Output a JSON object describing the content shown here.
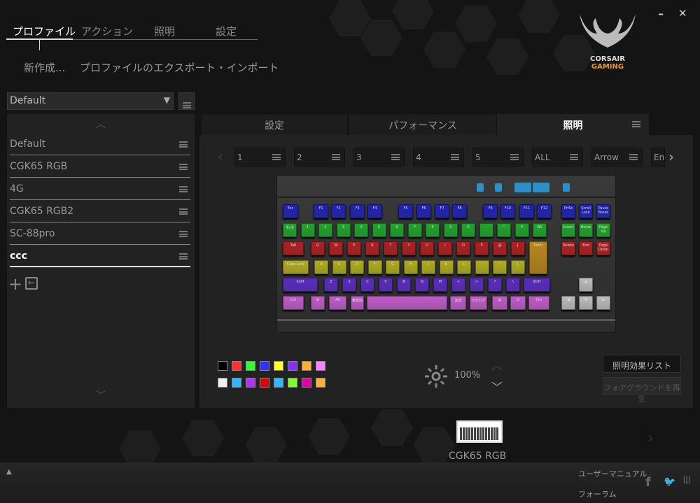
{
  "top_tabs": [
    "プロファイル",
    "アクション",
    "照明",
    "設定"
  ],
  "actions": {
    "new": "新作成...",
    "export_import": "プロファイルのエクスポート・インポート"
  },
  "logo": {
    "line1": "CORSAIR",
    "line2": "GAMING"
  },
  "window": {
    "minimize": "–",
    "close": "✕"
  },
  "profile_select": {
    "value": "Default"
  },
  "profiles": [
    "Default",
    "CGK65 RGB",
    "4G",
    "CGK65 RGB2",
    "SC-88pro",
    "ccc"
  ],
  "selected_profile": "ccc",
  "main_tabs": [
    "設定",
    "パフォーマンス",
    "照明"
  ],
  "active_main_tab": "照明",
  "sub_tabs": [
    "1",
    "2",
    "3",
    "4",
    "5",
    "ALL",
    "Arrow",
    "En"
  ],
  "keyboard": {
    "rows": [
      [
        "Esc",
        "F1",
        "F2",
        "F3",
        "F4",
        "F5",
        "F6",
        "F7",
        "F8",
        "F9",
        "F10",
        "F11",
        "F12",
        "PrtSc",
        "Scroll Lock",
        "Pause Break"
      ],
      [
        "半/全",
        "1",
        "2",
        "3",
        "4",
        "5",
        "6",
        "7",
        "8",
        "9",
        "0",
        "-",
        "^",
        "¥",
        "BS",
        "Insert",
        "Home",
        "Page Up"
      ],
      [
        "Tab",
        "Q",
        "W",
        "E",
        "R",
        "T",
        "Y",
        "U",
        "I",
        "O",
        "P",
        "@",
        "[",
        "Enter",
        "Delete",
        "End",
        "Page Down"
      ],
      [
        "Caps Lock",
        "A",
        "S",
        "D",
        "F",
        "G",
        "H",
        "J",
        "K",
        "L",
        ";",
        ":",
        "]"
      ],
      [
        "Shift",
        "Z",
        "X",
        "C",
        "V",
        "B",
        "N",
        "M",
        "<",
        ">",
        "?",
        "\\",
        "Shift",
        "▲"
      ],
      [
        "Ctrl",
        "⊞",
        "Alt",
        "無変換",
        "",
        "変換",
        "カタカナ",
        "▤",
        "⊡",
        "Ctrl",
        "◀",
        "▼",
        "▶"
      ]
    ],
    "row_colors": [
      "#1f22b4",
      "#1fa52a",
      "#b01f1f",
      "#b0ac1f",
      "#5a2bc0",
      "#c05cc8"
    ],
    "enter_color": "#b8861c",
    "arrow_color": "#bdbdbd"
  },
  "palette": [
    "#000000",
    "#ff3030",
    "#30ff30",
    "#3030ff",
    "#ffff30",
    "#8030ff",
    "#ffb030",
    "#ff80ff",
    "#f0f0f0",
    "#30b8ff",
    "#b030ff",
    "#e00000",
    "#30b8ff",
    "#80ff30",
    "#e000a0",
    "#ffb030"
  ],
  "brightness": "100%",
  "buttons": {
    "effects_list": "照明効果リスト",
    "play_foreground": "フォアグラウンドを再生"
  },
  "device": {
    "name": "CGK65 RGB"
  },
  "footer": {
    "manual": "ユーザーマニュアル",
    "forum": "フォーラム",
    "expand": "▲"
  }
}
